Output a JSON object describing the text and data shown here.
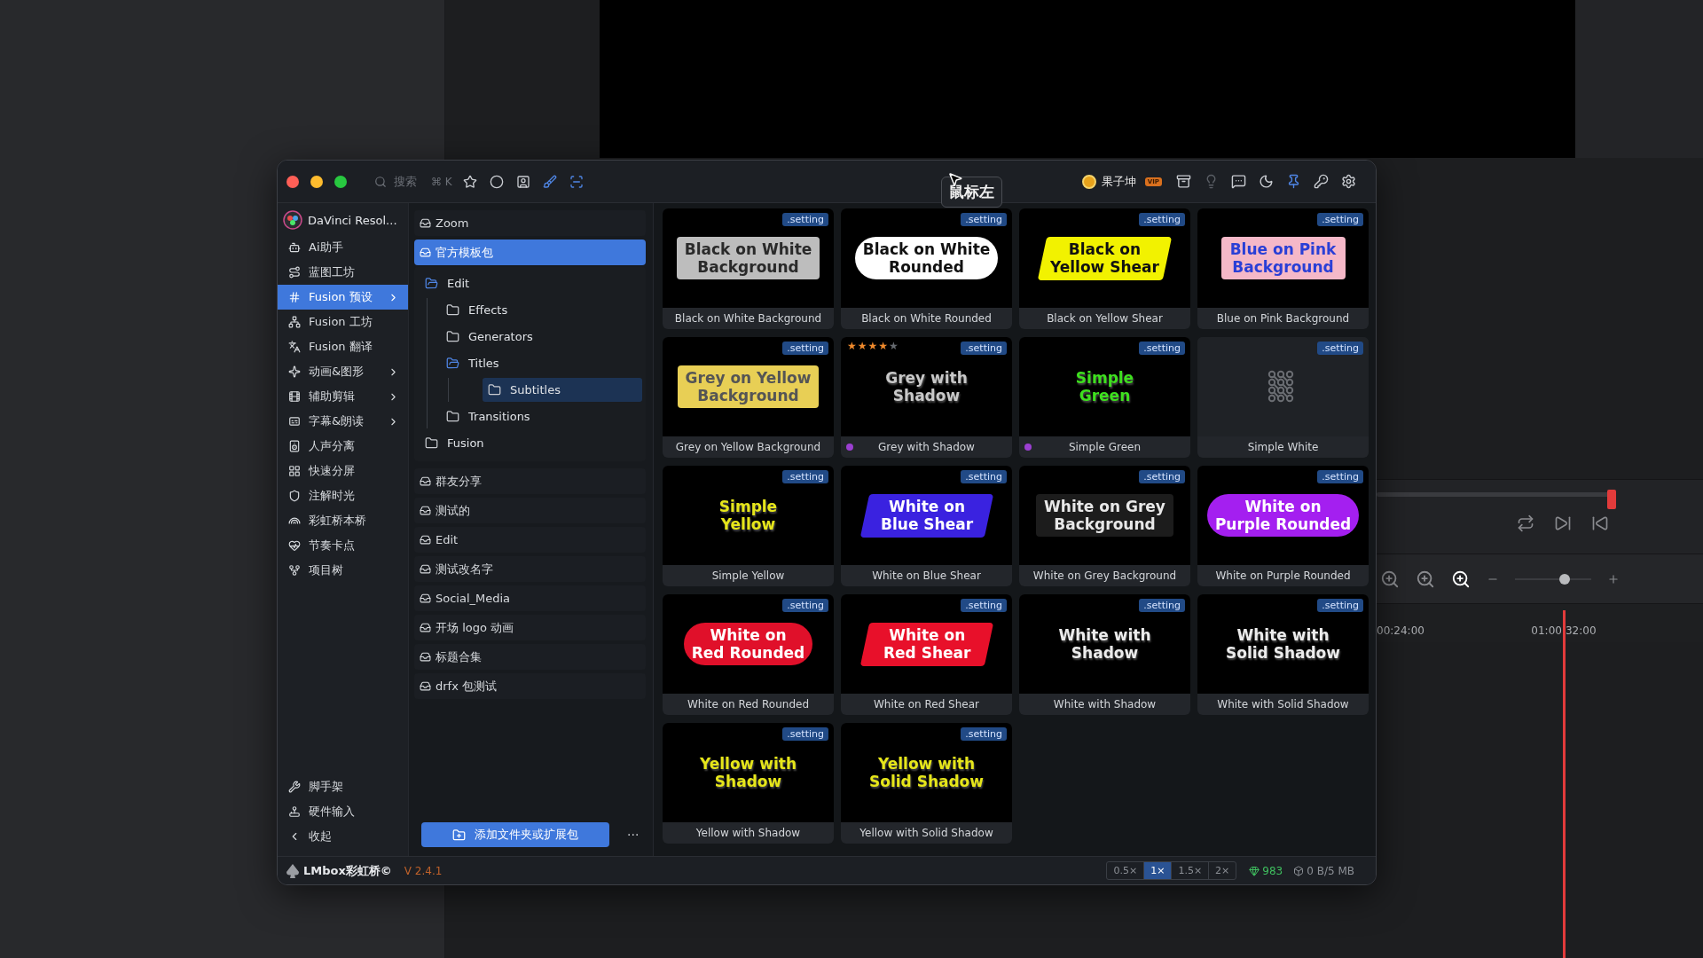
{
  "background": {
    "timecodes": [
      "00:24:00",
      "01:00:32:00"
    ],
    "zoom_slider": {
      "level": 0.65
    }
  },
  "titlebar": {
    "search": {
      "placeholder": "搜索",
      "shortcut": "⌘ K"
    },
    "user": {
      "name": "果子坤",
      "badge": "VIP"
    },
    "tooltip": "鼠标左"
  },
  "sidebar": {
    "header": "DaVinci Resol...",
    "items": [
      {
        "label": "Ai助手",
        "selected": false,
        "expandable": false
      },
      {
        "label": "蓝图工坊",
        "selected": false,
        "expandable": false
      },
      {
        "label": "Fusion 预设",
        "selected": true,
        "expandable": true
      },
      {
        "label": "Fusion 工坊",
        "selected": false,
        "expandable": false
      },
      {
        "label": "Fusion 翻译",
        "selected": false,
        "expandable": false
      },
      {
        "label": "动画&图形",
        "selected": false,
        "expandable": true
      },
      {
        "label": "辅助剪辑",
        "selected": false,
        "expandable": true
      },
      {
        "label": "字幕&朗读",
        "selected": false,
        "expandable": true
      },
      {
        "label": "人声分离",
        "selected": false,
        "expandable": false
      },
      {
        "label": "快速分屏",
        "selected": false,
        "expandable": false
      },
      {
        "label": "注解时光",
        "selected": false,
        "expandable": false
      },
      {
        "label": "彩虹桥本桥",
        "selected": false,
        "expandable": false
      },
      {
        "label": "节奏卡点",
        "selected": false,
        "expandable": false
      },
      {
        "label": "项目树",
        "selected": false,
        "expandable": false
      }
    ],
    "footer_items": [
      "脚手架",
      "硬件输入",
      "收起"
    ]
  },
  "packs": [
    {
      "label": "Zoom",
      "selected": false
    },
    {
      "label": "官方模板包",
      "selected": true,
      "children": [
        {
          "label": "Edit",
          "selected": false,
          "expanded": true,
          "children": [
            {
              "label": "Effects",
              "selected": false,
              "expanded": false
            },
            {
              "label": "Generators",
              "selected": false,
              "expanded": false
            },
            {
              "label": "Titles",
              "selected": false,
              "expanded": true,
              "children": [
                {
                  "label": "Subtitles",
                  "selected": true,
                  "expanded": false
                }
              ]
            },
            {
              "label": "Transitions",
              "selected": false,
              "expanded": false
            }
          ]
        },
        {
          "label": "Fusion",
          "selected": false,
          "expanded": false
        }
      ]
    },
    {
      "label": "群友分享",
      "selected": false
    },
    {
      "label": "测试的",
      "selected": false
    },
    {
      "label": "Edit",
      "selected": false
    },
    {
      "label": "测试改名字",
      "selected": false
    },
    {
      "label": "Social_Media",
      "selected": false
    },
    {
      "label": "开场 logo 动画",
      "selected": false
    },
    {
      "label": "标题合集",
      "selected": false
    },
    {
      "label": "drfx 包测试",
      "selected": false
    }
  ],
  "add_button": "添加文件夹或扩展包",
  "more_button": "···",
  "cards": [
    {
      "title": "Black on White Background",
      "badge": ".setting",
      "preview": {
        "kind": "box",
        "color": "#bdbdbd",
        "label": {
          "text": "Black on White\nBackground",
          "color": "#2a2a2a"
        }
      }
    },
    {
      "title": "Black on White Rounded",
      "badge": ".setting",
      "preview": {
        "kind": "pill",
        "color": "#ffffff",
        "label": {
          "text": "Black on White\nRounded",
          "color": "#111111"
        }
      }
    },
    {
      "title": "Black on Yellow Shear",
      "badge": ".setting",
      "preview": {
        "kind": "shear",
        "color": "#f2f200",
        "label": {
          "text": "Black on\nYellow Shear",
          "color": "#111111"
        }
      }
    },
    {
      "title": "Blue on Pink Background",
      "badge": ".setting",
      "preview": {
        "kind": "box",
        "color": "#f5b8c8",
        "label": {
          "text": "Blue on Pink\nBackground",
          "color": "#2a3fd6"
        }
      }
    },
    {
      "title": "Grey on Yellow Background",
      "badge": ".setting",
      "preview": {
        "kind": "box",
        "color": "#e8cf55",
        "label": {
          "text": "Grey on Yellow\nBackground",
          "color": "#555555"
        }
      }
    },
    {
      "title": "Grey with Shadow",
      "badge": ".setting",
      "stars": 4,
      "dot": {
        "color": "#9b3fd1"
      },
      "preview": {
        "kind": "plain",
        "label": {
          "text": "Grey with\nShadow",
          "color": "#c8c8c8"
        }
      }
    },
    {
      "title": "Simple Green",
      "badge": ".setting",
      "dot": {
        "color": "#9b3fd1"
      },
      "preview": {
        "kind": "plain",
        "label": {
          "text": "Simple\nGreen",
          "color": "#3ee01e"
        }
      }
    },
    {
      "title": "Simple White",
      "badge": ".setting",
      "preview": {
        "kind": "icon",
        "color": "#1f2226"
      }
    },
    {
      "title": "Simple Yellow",
      "badge": ".setting",
      "preview": {
        "kind": "plain",
        "label": {
          "text": "Simple\nYellow",
          "color": "#e6e61a"
        }
      }
    },
    {
      "title": "White on Blue Shear",
      "badge": ".setting",
      "preview": {
        "kind": "shear",
        "color": "#3a22e0",
        "label": {
          "text": "White on\nBlue Shear",
          "color": "#ffffff"
        }
      }
    },
    {
      "title": "White on Grey Background",
      "badge": ".setting",
      "preview": {
        "kind": "box",
        "color": "#1c1c1c",
        "label": {
          "text": "White on Grey\nBackground",
          "color": "#e8e8e8"
        }
      }
    },
    {
      "title": "White on Purple Rounded",
      "badge": ".setting",
      "preview": {
        "kind": "pill",
        "color": "#a41ff0",
        "label": {
          "text": "White on\nPurple Rounded",
          "color": "#ffffff"
        }
      }
    },
    {
      "title": "White on Red Rounded",
      "badge": ".setting",
      "preview": {
        "kind": "pill",
        "color": "#e0102a",
        "label": {
          "text": "White on\nRed Rounded",
          "color": "#ffffff"
        }
      }
    },
    {
      "title": "White on Red Shear",
      "badge": ".setting",
      "preview": {
        "kind": "shear",
        "color": "#e8102a",
        "label": {
          "text": "White on\nRed Shear",
          "color": "#ffffff"
        }
      }
    },
    {
      "title": "White with Shadow",
      "badge": ".setting",
      "preview": {
        "kind": "plain",
        "label": {
          "text": "White with\nShadow",
          "color": "#ececec"
        }
      }
    },
    {
      "title": "White with Solid Shadow",
      "badge": ".setting",
      "preview": {
        "kind": "plain",
        "label": {
          "text": "White with\nSolid Shadow",
          "color": "#ececec"
        }
      }
    },
    {
      "title": "Yellow with Shadow",
      "badge": ".setting",
      "preview": {
        "kind": "plain",
        "label": {
          "text": "Yellow with\nShadow",
          "color": "#e6e61a"
        }
      }
    },
    {
      "title": "Yellow with Solid Shadow",
      "badge": ".setting",
      "preview": {
        "kind": "plain",
        "label": {
          "text": "Yellow with\nSolid Shadow",
          "color": "#e6e61a"
        }
      }
    }
  ],
  "status_bar": {
    "brand": "LMbox彩虹桥©",
    "version": "V 2.4.1",
    "speeds": [
      {
        "label": "0.5×",
        "selected": false
      },
      {
        "label": "1×",
        "selected": true
      },
      {
        "label": "1.5×",
        "selected": false
      },
      {
        "label": "2×",
        "selected": false
      }
    ],
    "count": "983",
    "storage": "0 B/5 MB"
  }
}
